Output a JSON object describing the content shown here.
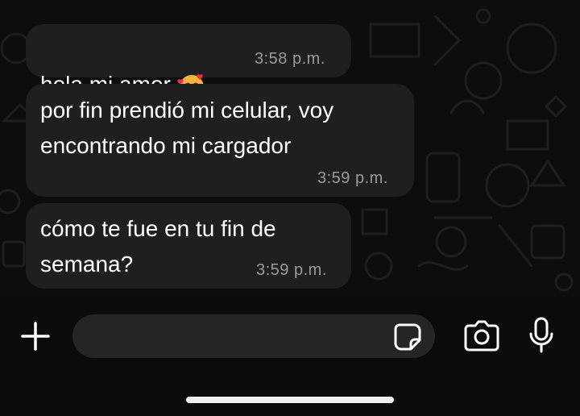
{
  "messages": [
    {
      "text": "hola mi amor",
      "emoji": "smiling-face-with-hearts",
      "time": "3:58 p.m."
    },
    {
      "text": "por fin prendió mi celular, voy\nencontrando mi cargador",
      "time": "3:59 p.m."
    },
    {
      "text": "cómo te fue en tu fin de\nsemana?",
      "time": "3:59 p.m."
    }
  ],
  "composer": {
    "placeholder": "",
    "icons": [
      "plus-icon",
      "sticker-icon",
      "camera-icon",
      "microphone-icon"
    ]
  },
  "colors": {
    "background": "#0b0b0b",
    "bubble": "#1f1f1f",
    "time": "#9a9a9a",
    "input": "#252525"
  }
}
